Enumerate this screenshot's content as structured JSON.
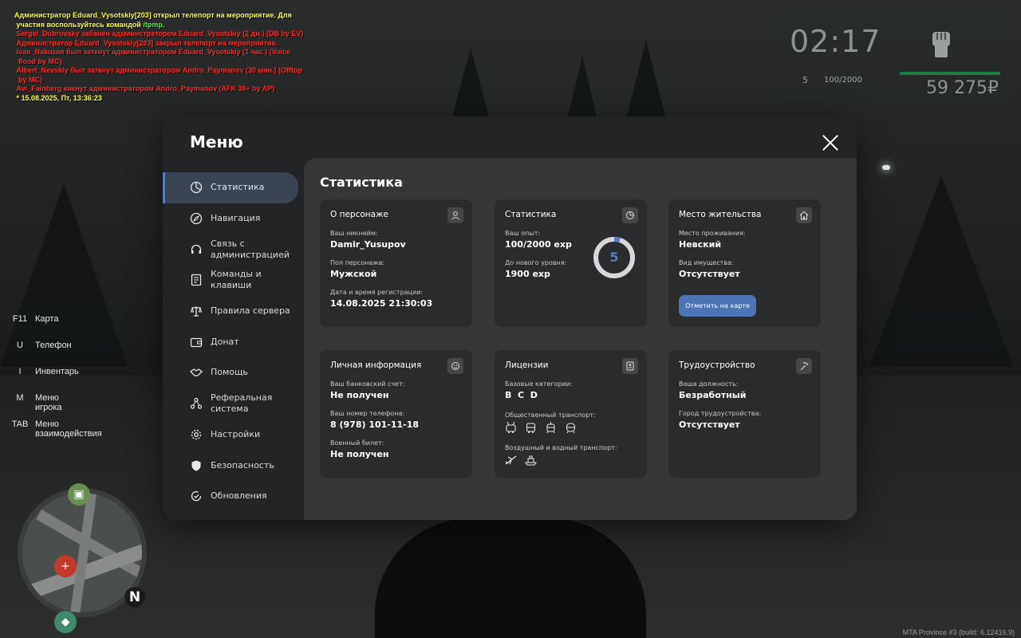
{
  "chat": [
    {
      "parts": [
        {
          "text": "Администратор Eduard_Vysotskiy[203] открыл телепорт на мероприятие. Для\n участия воспользуйтесь командой ",
          "color": "y"
        },
        {
          "text": "/tpmp",
          "color": "g"
        },
        {
          "text": ".",
          "color": "y"
        }
      ]
    },
    {
      "parts": [
        {
          "text": " Sergei_Dubrovsky забанен администратором Eduard_Vysotskiy (2 дн.) (DB by EV)",
          "color": "r"
        }
      ]
    },
    {
      "parts": [
        {
          "text": " Администратор Eduard_Vysotskiy[203] закрыл телепорт на мероприятие.",
          "color": "r"
        }
      ]
    },
    {
      "parts": [
        {
          "text": " Ivan_Rakuzan был заткнут администратором Eduard_Vysotskiy (1 час.) (Voice\n  flood by MC)",
          "color": "r"
        }
      ]
    },
    {
      "parts": [
        {
          "text": " Albert_Nevskiy был заткнут администратором Andro_Paymanov (30 мин.) (Offtop\n  by MC)",
          "color": "r"
        }
      ]
    },
    {
      "parts": [
        {
          "text": " Avi_Fainberg кикнут администратором Andro_Paymanov (AFK 30+ by AP)",
          "color": "r"
        }
      ]
    },
    {
      "parts": [
        {
          "text": " * 15.08.2025, Пт, 13:36:23",
          "color": "y"
        }
      ]
    }
  ],
  "hud": {
    "time": "02:17",
    "level": "5",
    "exp": "100/2000",
    "money": "59 275₽",
    "health_color": "#1e7a3e"
  },
  "hints": [
    {
      "key": "F11",
      "label": "Карта"
    },
    {
      "key": "U",
      "label": "Телефон"
    },
    {
      "key": "I",
      "label": "Инвентарь"
    },
    {
      "key": "M",
      "label": "Меню игрока"
    },
    {
      "key": "TAB",
      "label": "Меню взаимодействия"
    }
  ],
  "minimap": {
    "north": "N"
  },
  "build": "MTA Province #3 (build: 6.12416.9)",
  "menu": {
    "title": "Меню",
    "nav": [
      {
        "label": "Статистика",
        "icon": "pie-chart-icon",
        "active": true
      },
      {
        "label": "Навигация",
        "icon": "compass-icon"
      },
      {
        "label": "Связь с\nадминистрацией",
        "icon": "headset-icon"
      },
      {
        "label": "Команды и клавиши",
        "icon": "document-list-icon"
      },
      {
        "label": "Правила сервера",
        "icon": "scales-icon"
      },
      {
        "label": "Донат",
        "icon": "wallet-icon"
      },
      {
        "label": "Помощь",
        "icon": "handshake-icon"
      },
      {
        "label": "Реферальная\nсистема",
        "icon": "network-icon"
      },
      {
        "label": "Настройки",
        "icon": "gear-icon"
      },
      {
        "label": "Безопасность",
        "icon": "shield-icon"
      },
      {
        "label": "Обновления",
        "icon": "check-refresh-icon"
      }
    ],
    "content_title": "Статистика",
    "cards": {
      "about": {
        "title": "О персонаже",
        "nick_label": "Ваш никнейм:",
        "nick": "Damir_Yusupov",
        "gender_label": "Пол персонажа:",
        "gender": "Мужской",
        "reg_label": "Дата и время регистрации:",
        "reg": "14.08.2025 21:30:03"
      },
      "stats": {
        "title": "Статистика",
        "exp_label": "Ваш опыт:",
        "exp": "100/2000 exp",
        "next_label": "До нового уровня:",
        "next": "1900 exp",
        "level": "5",
        "progress": 0.05,
        "accent": "#5b7dbd"
      },
      "residence": {
        "title": "Место жительства",
        "place_label": "Место проживания:",
        "place": "Невский",
        "property_label": "Вид имущества:",
        "property": "Отсутствует",
        "button": "Отметить на карте"
      },
      "personal": {
        "title": "Личная информация",
        "bank_label": "Ваш банковский счет:",
        "bank": "Не получен",
        "phone_label": "Ваш номер телефона:",
        "phone": "8 (978) 101-11-18",
        "military_label": "Военный билет:",
        "military": "Не получен"
      },
      "licenses": {
        "title": "Лицензии",
        "base_label": "Базовые категории:",
        "base": "B  C  D",
        "public_label": "Общественный транспорт:",
        "air_label": "Воздушный и водный транспорт:"
      },
      "job": {
        "title": "Трудоустройство",
        "position_label": "Ваша должность:",
        "position": "Безработный",
        "city_label": "Город трудоустройства:",
        "city": "Отсутствует"
      }
    }
  }
}
